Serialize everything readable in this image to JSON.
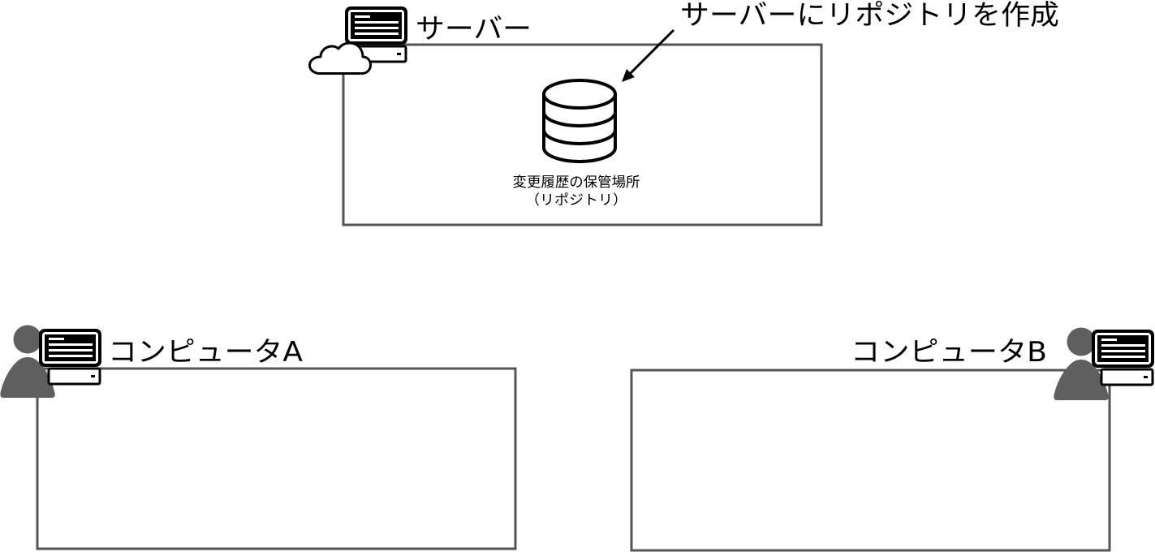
{
  "colors": {
    "background": "#ffffff",
    "box_stroke": "#555555",
    "icon": "#000000",
    "person": "#5f5f5f"
  },
  "server": {
    "label": "サーバー",
    "icon": "server-cloud-icon",
    "repository": {
      "icon": "database-icon",
      "caption_line1": "変更履歴の保管場所",
      "caption_line2": "（リポジトリ）"
    }
  },
  "annotation": {
    "text": "サーバーにリポジトリを作成",
    "pointer": "arrow-icon"
  },
  "computer_a": {
    "label": "コンピュータA",
    "icon": "user-computer-icon"
  },
  "computer_b": {
    "label": "コンピュータB",
    "icon": "user-computer-icon"
  }
}
